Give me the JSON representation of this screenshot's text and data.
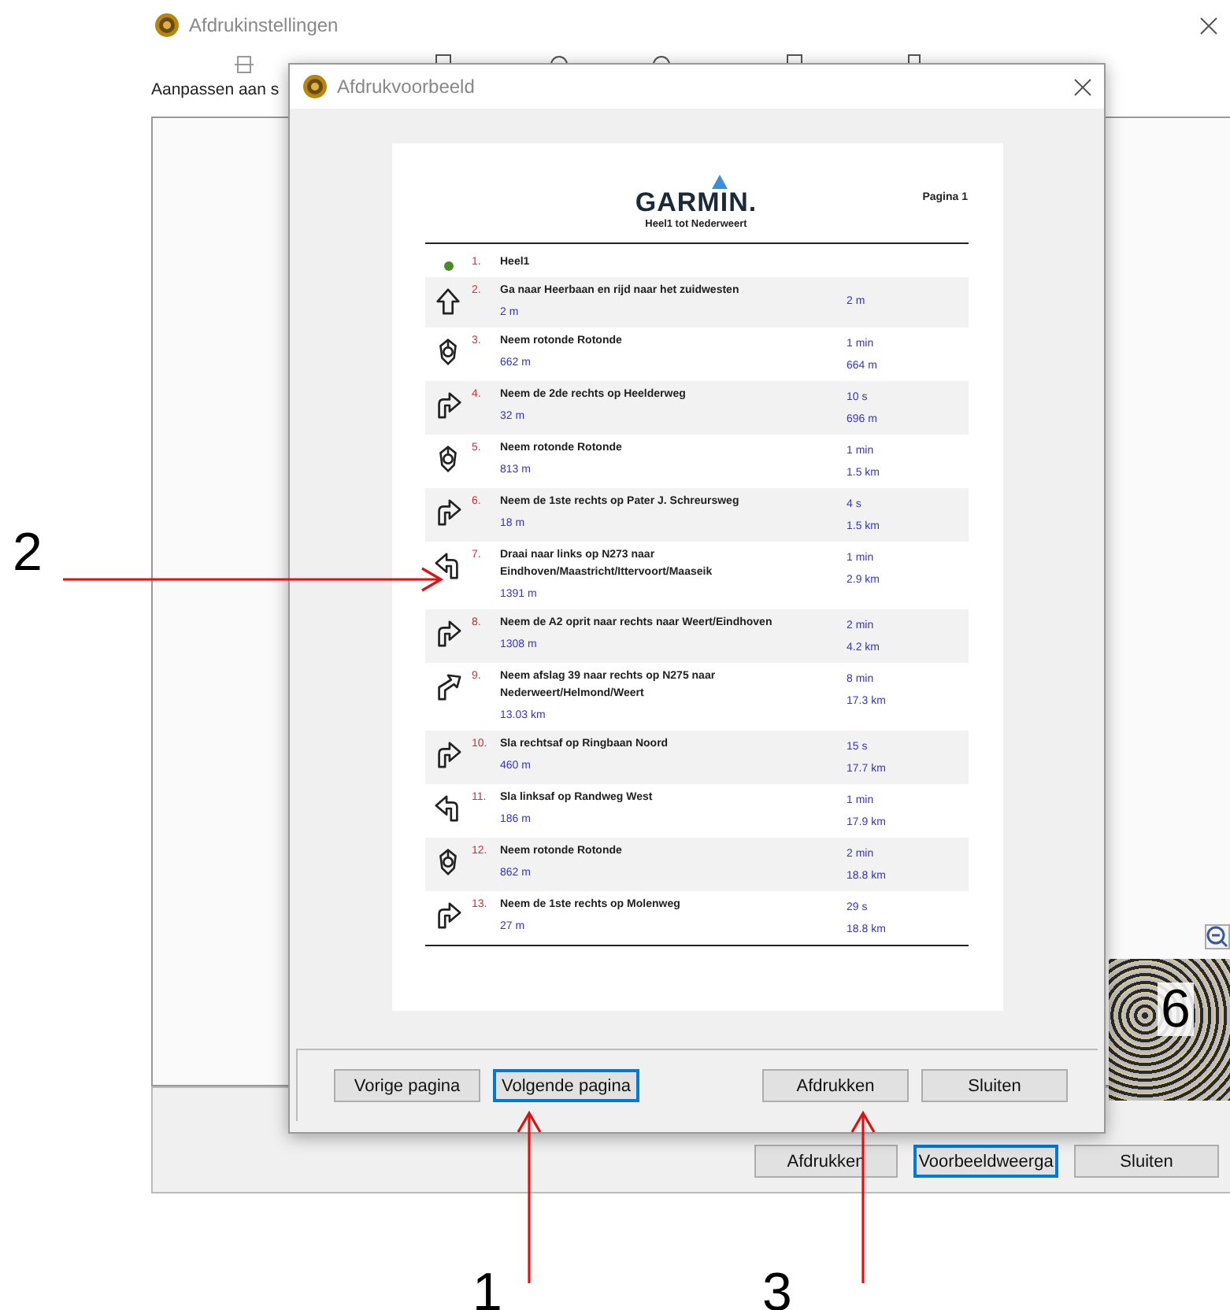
{
  "back_window": {
    "title": "Afdrukinstellingen",
    "toolbar_label": "Aanpassen aan s",
    "buttons": [
      {
        "label": "Afdrukken",
        "selected": false
      },
      {
        "label": "Voorbeeldweerga",
        "selected": true
      },
      {
        "label": "Sluiten",
        "selected": false
      }
    ]
  },
  "preview_dialog": {
    "title": "Afdrukvoorbeeld",
    "page": {
      "logo": "GARMIN.",
      "subtitle": "Heel1 tot Nederweert",
      "page_number": "Pagina 1",
      "steps": [
        {
          "kind": "start",
          "number": "1.",
          "text": "Heel1"
        },
        {
          "kind": "straight",
          "number": "2.",
          "text": "Ga naar Heerbaan en rijd naar het zuidwesten",
          "distance": "2 m",
          "right": [
            "2 m"
          ]
        },
        {
          "kind": "roundabout",
          "number": "3.",
          "text": "Neem rotonde Rotonde",
          "distance": "662 m",
          "right": [
            "1 min",
            "664 m"
          ]
        },
        {
          "kind": "right",
          "number": "4.",
          "text": "Neem de 2de rechts op Heelderweg",
          "distance": "32 m",
          "right": [
            "10 s",
            "696 m"
          ]
        },
        {
          "kind": "roundabout",
          "number": "5.",
          "text": "Neem rotonde Rotonde",
          "distance": "813 m",
          "right": [
            "1 min",
            "1.5 km"
          ]
        },
        {
          "kind": "right",
          "number": "6.",
          "text": "Neem de 1ste rechts op Pater J. Schreursweg",
          "distance": "18 m",
          "right": [
            "4 s",
            "1.5 km"
          ]
        },
        {
          "kind": "left",
          "number": "7.",
          "text": "Draai naar links op N273 naar Eindhoven/Maastricht/Ittervoort/Maaseik",
          "distance": "1391 m",
          "right": [
            "1 min",
            "2.9 km"
          ]
        },
        {
          "kind": "right",
          "number": "8.",
          "text": "Neem de A2 oprit naar rechts naar Weert/Eindhoven",
          "distance": "1308 m",
          "right": [
            "2 min",
            "4.2 km"
          ]
        },
        {
          "kind": "slight-right",
          "number": "9.",
          "text": "Neem afslag 39 naar rechts op N275 naar Nederweert/Helmond/Weert",
          "distance": "13.03 km",
          "right": [
            "8 min",
            "17.3 km"
          ]
        },
        {
          "kind": "right",
          "number": "10.",
          "text": "Sla rechtsaf op Ringbaan Noord",
          "distance": "460 m",
          "right": [
            "15 s",
            "17.7 km"
          ]
        },
        {
          "kind": "left",
          "number": "11.",
          "text": "Sla linksaf op Randweg West",
          "distance": "186 m",
          "right": [
            "1 min",
            "17.9 km"
          ]
        },
        {
          "kind": "roundabout",
          "number": "12.",
          "text": "Neem rotonde Rotonde",
          "distance": "862 m",
          "right": [
            "2 min",
            "18.8 km"
          ]
        },
        {
          "kind": "right",
          "number": "13.",
          "text": "Neem de 1ste rechts op Molenweg",
          "distance": "27 m",
          "right": [
            "29 s",
            "18.8 km"
          ]
        }
      ]
    },
    "buttons": [
      {
        "label": "Vorige pagina",
        "selected": false
      },
      {
        "label": "Volgende pagina",
        "selected": true
      },
      {
        "label": "Afdrukken",
        "selected": false
      },
      {
        "label": "Sluiten",
        "selected": false
      }
    ]
  },
  "annotations": [
    {
      "label": "2",
      "kind": "arrow-right"
    },
    {
      "label": "1",
      "kind": "arrow-up"
    },
    {
      "label": "3",
      "kind": "arrow-up"
    },
    {
      "label": "6",
      "kind": "label"
    }
  ]
}
